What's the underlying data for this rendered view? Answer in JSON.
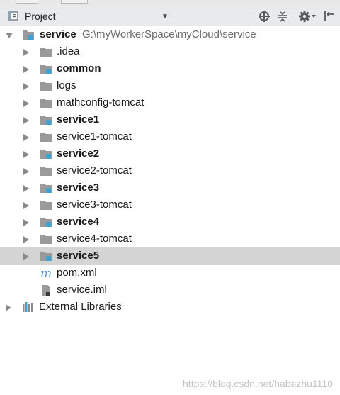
{
  "panel": {
    "title": "Project"
  },
  "tree": {
    "root": {
      "label": "service",
      "path": "G:\\myWorkerSpace\\myCloud\\service"
    },
    "children": [
      {
        "label": ".idea",
        "type": "folder",
        "bold": false
      },
      {
        "label": "common",
        "type": "module",
        "bold": true
      },
      {
        "label": "logs",
        "type": "folder",
        "bold": false
      },
      {
        "label": "mathconfig-tomcat",
        "type": "folder",
        "bold": false
      },
      {
        "label": "service1",
        "type": "module",
        "bold": true
      },
      {
        "label": "service1-tomcat",
        "type": "folder",
        "bold": false
      },
      {
        "label": "service2",
        "type": "module",
        "bold": true
      },
      {
        "label": "service2-tomcat",
        "type": "folder",
        "bold": false
      },
      {
        "label": "service3",
        "type": "module",
        "bold": true
      },
      {
        "label": "service3-tomcat",
        "type": "folder",
        "bold": false
      },
      {
        "label": "service4",
        "type": "module",
        "bold": true
      },
      {
        "label": "service4-tomcat",
        "type": "folder",
        "bold": false
      },
      {
        "label": "service5",
        "type": "module",
        "bold": true,
        "selected": true
      }
    ],
    "files": [
      {
        "label": "pom.xml",
        "icon": "maven-icon"
      },
      {
        "label": "service.iml",
        "icon": "iml-file-icon"
      }
    ],
    "external": {
      "label": "External Libraries"
    }
  },
  "watermark": "https://blog.csdn.net/habazhu1110",
  "colors": {
    "header_bg": "#e9eaec",
    "selection_bg": "#d4d4d4",
    "folder_gray": "#9a9a9a",
    "module_badge": "#3aa3d8",
    "maven_blue": "#4a8fd6"
  }
}
